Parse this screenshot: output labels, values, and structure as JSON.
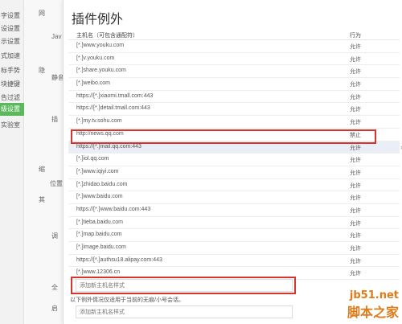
{
  "sidebar": {
    "items": [
      {
        "label": "字设置",
        "active": false
      },
      {
        "label": "设设置",
        "active": false
      },
      {
        "label": "示设置",
        "active": false
      },
      {
        "label": "式加速",
        "active": false
      },
      {
        "label": "标手势",
        "active": false
      },
      {
        "label": "块捷键",
        "active": false
      },
      {
        "label": "告过滤",
        "active": false
      },
      {
        "label": "级设置",
        "active": true
      },
      {
        "label": "实验室",
        "active": false
      }
    ]
  },
  "settings_strip": {
    "labels": [
      "网",
      "Jav",
      "隐",
      "静音",
      "插",
      "缩",
      "位置",
      "其",
      "调",
      "全",
      "启"
    ]
  },
  "dialog": {
    "title": "插件例外",
    "col_host": "主机名（可包含通配符）",
    "col_action": "行为",
    "rows": [
      {
        "host": "[*.]www.youku.com",
        "action": "允许"
      },
      {
        "host": "[*.]v.youku.com",
        "action": "允许"
      },
      {
        "host": "[*.]share.youku.com",
        "action": "允许"
      },
      {
        "host": "[*.]weibo.com",
        "action": "允许"
      },
      {
        "host": "https://[*.]xiaomi.tmall.com:443",
        "action": "允许"
      },
      {
        "host": "https://[*.]detail.tmall.com:443",
        "action": "允许"
      },
      {
        "host": "[*.]my.tv.sohu.com",
        "action": "允许"
      },
      {
        "host": "http://news.qq.com",
        "action": "禁止"
      },
      {
        "host": "https://[*.]mail.qq.com:443",
        "action": "允许"
      },
      {
        "host": "[*.]iol.qq.com",
        "action": "允许"
      },
      {
        "host": "[*.]www.iqiyi.com",
        "action": "允许"
      },
      {
        "host": "[*.]zhidao.baidu.com",
        "action": "允许"
      },
      {
        "host": "[*.]www.baidu.com",
        "action": "允许"
      },
      {
        "host": "https://[*.]www.baidu.com:443",
        "action": "允许"
      },
      {
        "host": "[*.]tieba.baidu.com",
        "action": "允许"
      },
      {
        "host": "[*.]map.baidu.com",
        "action": "允许"
      },
      {
        "host": "[*.]image.baidu.com",
        "action": "允许"
      },
      {
        "host": "https://[*.]authsu18.alipay.com:443",
        "action": "允许"
      },
      {
        "host": "[*.]www.12306.cn",
        "action": "允许"
      }
    ],
    "add_placeholder": "添加新主机名样式",
    "note": "以下例外情况仅适用于当前的无痕/小号会话。",
    "add_placeholder_2": "添加新主机名样式"
  },
  "watermark": {
    "site": "jb51.net",
    "name": "脚本之家"
  },
  "colors": {
    "active_nav": "#5cb85c",
    "highlight_row": "#eaeff7",
    "annotation_red": "#d9342b",
    "watermark": "#e07b1a"
  }
}
